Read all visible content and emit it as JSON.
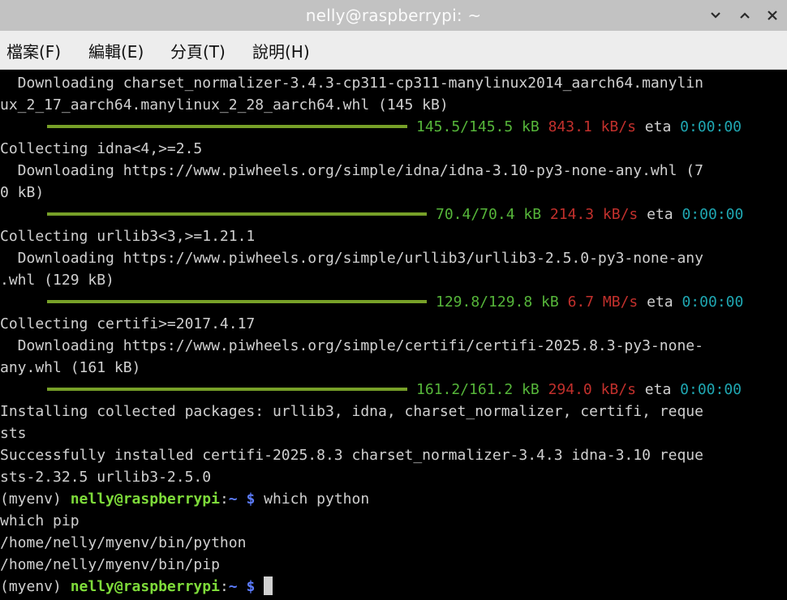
{
  "window": {
    "title": "nelly@raspberrypi: ~"
  },
  "menu": [
    "檔案(F)",
    "編輯(E)",
    "分頁(T)",
    "說明(H)"
  ],
  "lines": {
    "l1": "  Downloading charset_normalizer-3.4.3-cp311-cp311-manylinux2014_aarch64.manylin",
    "l2": "ux_2_17_aarch64.manylinux_2_28_aarch64.whl (145 kB)",
    "l4": "Collecting idna<4,>=2.5",
    "l5": "  Downloading https://www.piwheels.org/simple/idna/idna-3.10-py3-none-any.whl (7",
    "l6": "0 kB)",
    "l8": "Collecting urllib3<3,>=1.21.1",
    "l9": "  Downloading https://www.piwheels.org/simple/urllib3/urllib3-2.5.0-py3-none-any",
    "l10": ".whl (129 kB)",
    "l12": "Collecting certifi>=2017.4.17",
    "l13": "  Downloading https://www.piwheels.org/simple/certifi/certifi-2025.8.3-py3-none-",
    "l14": "any.whl (161 kB)",
    "l16": "Installing collected packages: urllib3, idna, charset_normalizer, certifi, reque",
    "l17": "sts",
    "l18": "Successfully installed certifi-2025.8.3 charset_normalizer-3.4.3 idna-3.10 reque",
    "l19": "sts-2.32.5 urllib3-2.5.0",
    "l21": "which pip",
    "l22": "/home/nelly/myenv/bin/python",
    "l23": "/home/nelly/myenv/bin/pip"
  },
  "progress": [
    {
      "size": "145.5/145.5 kB",
      "speed": "843.1 kB/s",
      "eta_label": "eta",
      "eta": "0:00:00",
      "complete": 1.0
    },
    {
      "size": "70.4/70.4 kB",
      "speed": "214.3 kB/s",
      "eta_label": "eta",
      "eta": "0:00:00",
      "complete": 1.0
    },
    {
      "size": "129.8/129.8 kB",
      "speed": "6.7 MB/s",
      "eta_label": "eta",
      "eta": "0:00:00",
      "complete": 1.0
    },
    {
      "size": "161.2/161.2 kB",
      "speed": "294.0 kB/s",
      "eta_label": "eta",
      "eta": "0:00:00",
      "complete": 1.0
    }
  ],
  "prompt": {
    "env": "(myenv) ",
    "user": "nelly@raspberrypi",
    "colon": ":",
    "path": "~",
    "dollar": " $",
    "command1": " which python",
    "command2": " "
  },
  "colors": {
    "titlebar": "#c2c2c2",
    "menubar": "#ededed",
    "terminal_bg": "#000000",
    "progress_bar": "#77a028",
    "size_text": "#56b63a",
    "speed_text": "#c2302c",
    "eta_value": "#1fa7b2",
    "prompt_user": "#7edb3a",
    "prompt_path": "#5c7cff"
  },
  "icons": {
    "minimize": "chevron-down-icon",
    "maximize": "chevron-up-icon",
    "close": "close-icon"
  }
}
